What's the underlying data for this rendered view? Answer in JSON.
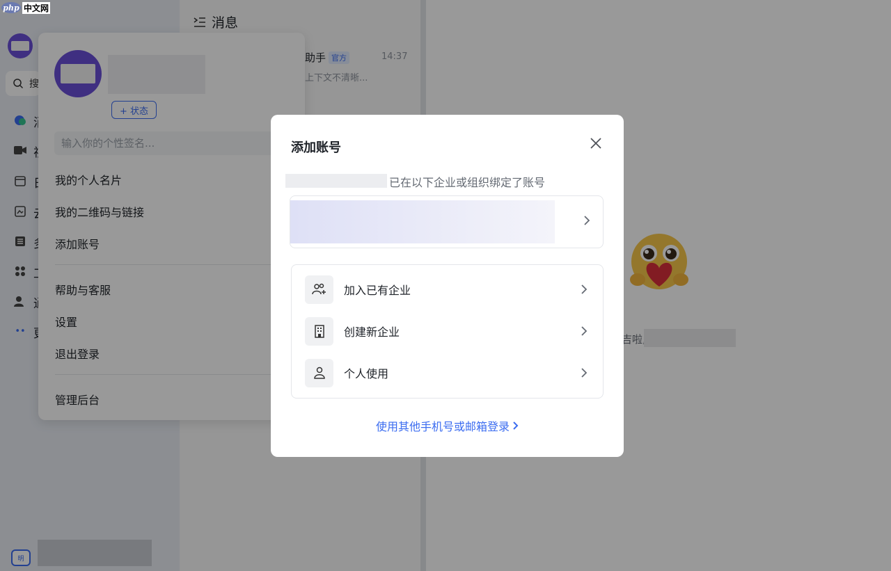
{
  "watermark": {
    "logo_left": "php",
    "logo_right": "中文网"
  },
  "sidebar": {
    "search_hint": "搜",
    "items": [
      {
        "icon": "chat-icon",
        "label": "消"
      },
      {
        "icon": "video-icon",
        "label": "视"
      },
      {
        "icon": "calendar-icon",
        "label": "日"
      },
      {
        "icon": "docs-icon",
        "label": "云"
      },
      {
        "icon": "table-icon",
        "label": "多"
      },
      {
        "icon": "apps-icon",
        "label": "工"
      },
      {
        "icon": "contacts-icon",
        "label": "通"
      },
      {
        "icon": "more-icon",
        "label": "更"
      }
    ],
    "bottom_badge": "明"
  },
  "messages": {
    "header": "消息",
    "item": {
      "title": "助手",
      "tag": "官方",
      "time": "14:37",
      "preview": "上下文不清晰..."
    }
  },
  "main": {
    "greeting_fragment": "吉啦,"
  },
  "profile": {
    "status_button": "+ 状态",
    "signature_placeholder": "输入你的个性签名...",
    "menu": [
      "我的个人名片",
      "我的二维码与链接",
      "添加账号"
    ],
    "menu2": [
      "帮助与客服",
      "设置",
      "退出登录"
    ],
    "menu3": [
      "管理后台"
    ]
  },
  "dialog": {
    "title": "添加账号",
    "bound_text": "已在以下企业或组织绑定了账号",
    "options": [
      {
        "icon": "join-team-icon",
        "label": "加入已有企业"
      },
      {
        "icon": "building-icon",
        "label": "创建新企业"
      },
      {
        "icon": "person-icon",
        "label": "个人使用"
      }
    ],
    "alt_login": "使用其他手机号或邮箱登录"
  }
}
